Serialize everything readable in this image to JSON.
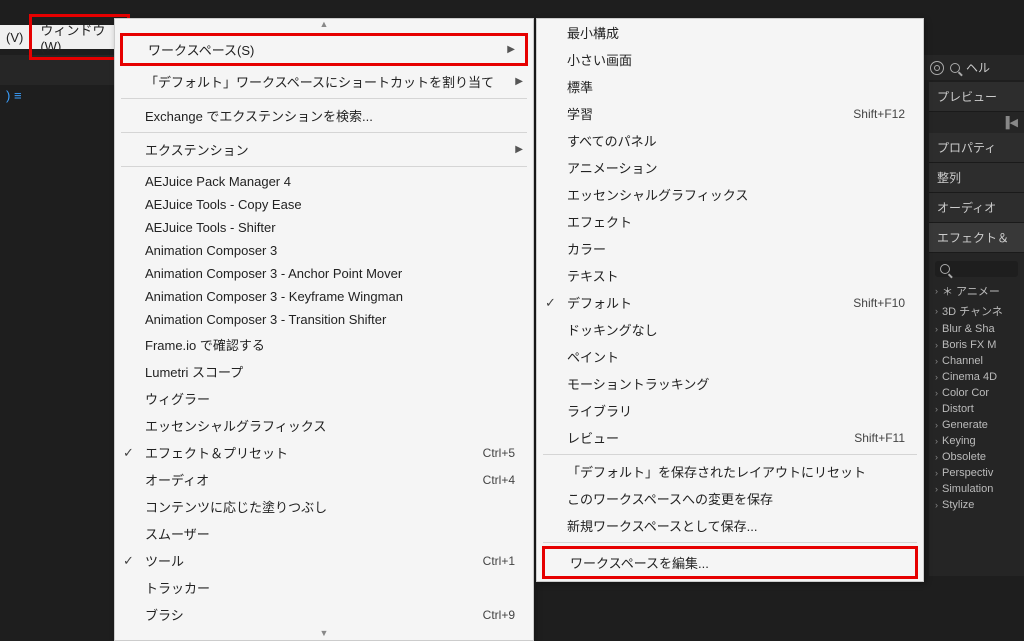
{
  "menubar": {
    "view_fragment": "(V)",
    "window": "ウィンドウ(W)"
  },
  "topright": {
    "search_placeholder": "ヘル"
  },
  "menu1": {
    "items": [
      {
        "label": "ワークスペース(S)",
        "type": "submenu",
        "highlight": true
      },
      {
        "label": "「デフォルト」ワークスペースにショートカットを割り当て",
        "type": "submenu"
      },
      {
        "type": "sep"
      },
      {
        "label": "Exchange でエクステンションを検索..."
      },
      {
        "type": "sep"
      },
      {
        "label": "エクステンション",
        "type": "submenu"
      },
      {
        "type": "sep"
      },
      {
        "label": "AEJuice Pack Manager 4"
      },
      {
        "label": "AEJuice Tools - Copy Ease"
      },
      {
        "label": "AEJuice Tools - Shifter"
      },
      {
        "label": "Animation Composer 3"
      },
      {
        "label": "Animation Composer 3 - Anchor Point Mover"
      },
      {
        "label": "Animation Composer 3 - Keyframe Wingman"
      },
      {
        "label": "Animation Composer 3 - Transition Shifter"
      },
      {
        "label": "Frame.io で確認する"
      },
      {
        "label": "Lumetri スコープ"
      },
      {
        "label": "ウィグラー"
      },
      {
        "label": "エッセンシャルグラフィックス"
      },
      {
        "label": "エフェクト＆プリセット",
        "checked": true,
        "shortcut": "Ctrl+5"
      },
      {
        "label": "オーディオ",
        "shortcut": "Ctrl+4"
      },
      {
        "label": "コンテンツに応じた塗りつぶし"
      },
      {
        "label": "スムーザー"
      },
      {
        "label": "ツール",
        "checked": true,
        "shortcut": "Ctrl+1"
      },
      {
        "label": "トラッカー"
      },
      {
        "label": "ブラシ",
        "shortcut": "Ctrl+9"
      }
    ]
  },
  "menu2": {
    "items": [
      {
        "label": "最小構成"
      },
      {
        "label": "小さい画面"
      },
      {
        "label": "標準"
      },
      {
        "label": "学習",
        "shortcut": "Shift+F12"
      },
      {
        "label": "すべてのパネル"
      },
      {
        "label": "アニメーション"
      },
      {
        "label": "エッセンシャルグラフィックス"
      },
      {
        "label": "エフェクト"
      },
      {
        "label": "カラー"
      },
      {
        "label": "テキスト"
      },
      {
        "label": "デフォルト",
        "checked": true,
        "shortcut": "Shift+F10"
      },
      {
        "label": "ドッキングなし"
      },
      {
        "label": "ペイント"
      },
      {
        "label": "モーショントラッキング"
      },
      {
        "label": "ライブラリ"
      },
      {
        "label": "レビュー",
        "shortcut": "Shift+F11"
      },
      {
        "type": "sep"
      },
      {
        "label": "「デフォルト」を保存されたレイアウトにリセット"
      },
      {
        "label": "このワークスペースへの変更を保存"
      },
      {
        "label": "新規ワークスペースとして保存..."
      },
      {
        "type": "sep"
      },
      {
        "label": "ワークスペースを編集...",
        "highlight": true
      }
    ]
  },
  "rightcol": {
    "panels": [
      {
        "title": "プレビュー",
        "type": "preview"
      },
      {
        "title": "プロパティ"
      },
      {
        "title": "整列"
      },
      {
        "title": "オーディオ"
      },
      {
        "title": "エフェクト＆",
        "type": "effects"
      }
    ],
    "effects_items": [
      "＊ アニメー",
      "3D チャンネ",
      "Blur & Sha",
      "Boris FX M",
      "Channel",
      "Cinema 4D",
      "Color Cor",
      "Distort",
      "Generate",
      "Keying",
      "Obsolete",
      "Perspectiv",
      "Simulation",
      "Stylize"
    ],
    "search_placeholder": ""
  },
  "leftblue": ")  ≡"
}
